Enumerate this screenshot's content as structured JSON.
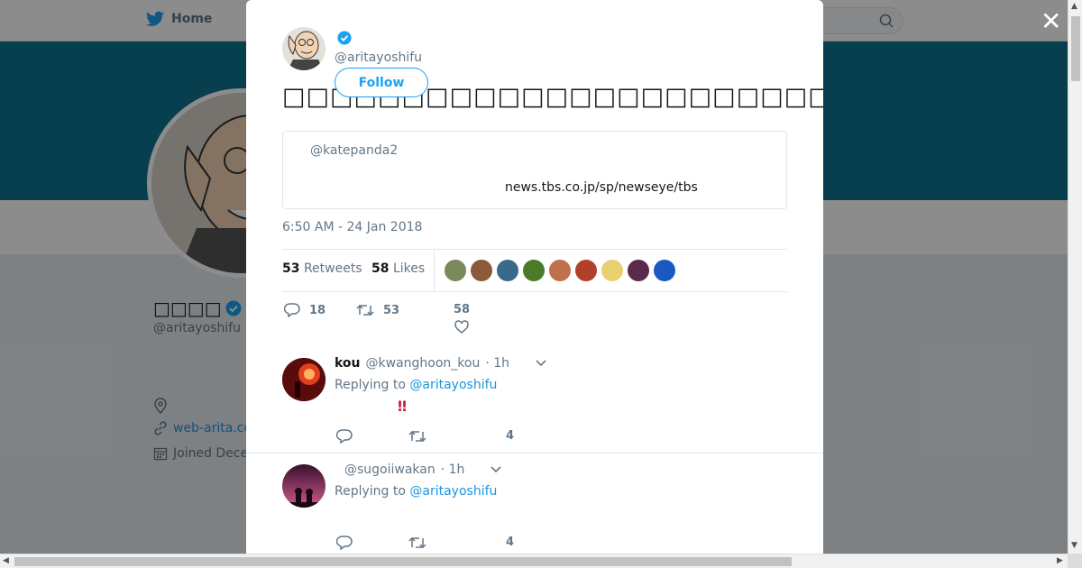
{
  "nav": {
    "home_label": "Home"
  },
  "profile": {
    "name": "□□□□",
    "handle": "@aritayoshifu",
    "website": "web-arita.co",
    "joined": "Joined Dece",
    "banner_ghost": "",
    "location": ""
  },
  "modal": {
    "close_glyph": "✕",
    "author": {
      "handle": "@aritayoshifu",
      "verified": true
    },
    "follow_label": "Follow",
    "tweet_text": "□□□□□□□□□□□□□□□□□□□□□□□□□□□□□□□□□□□□□□□□□□□□□□□□□□",
    "quote": {
      "handle": "@katepanda2",
      "link": "news.tbs.co.jp/sp/newseye/tbs"
    },
    "timestamp": "6:50 AM - 24 Jan 2018",
    "stats": {
      "retweets_count": "53",
      "retweets_label": "Retweets",
      "likes_count": "58",
      "likes_label": "Likes"
    },
    "likers": [
      {
        "name": "liker-avatar",
        "color": "#7a8a5a"
      },
      {
        "name": "liker-avatar",
        "color": "#8a5a3a"
      },
      {
        "name": "liker-avatar",
        "color": "#3a6a8a"
      },
      {
        "name": "liker-avatar",
        "color": "#4a7a2a"
      },
      {
        "name": "liker-avatar",
        "color": "#c0704a"
      },
      {
        "name": "liker-avatar",
        "color": "#b0402a"
      },
      {
        "name": "liker-avatar",
        "color": "#e8d070"
      },
      {
        "name": "liker-avatar",
        "color": "#5a2a4a"
      },
      {
        "name": "liker-avatar",
        "color": "#1a5ac0"
      }
    ],
    "actions": {
      "replies": "18",
      "retweets": "53",
      "likes": "58"
    },
    "replies": [
      {
        "display_name": "kou",
        "handle": "@kwanghoon_kou",
        "time": "· 1h",
        "replying_prefix": "Replying to",
        "replying_to": "@aritayoshifu",
        "text_tail": "‼",
        "likes": "4"
      },
      {
        "display_name": "",
        "handle": "@sugoiiwakan",
        "time": "· 1h",
        "replying_prefix": "Replying to",
        "replying_to": "@aritayoshifu",
        "likes": "4"
      }
    ]
  },
  "colors": {
    "accent": "#1da1f2",
    "banner": "#0f7491",
    "link": "#1b95e0"
  }
}
